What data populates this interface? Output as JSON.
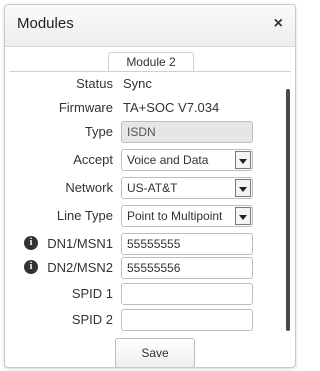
{
  "dialog": {
    "title": "Modules",
    "close_glyph": "×",
    "tab_label": "Module 2",
    "save_label": "Save"
  },
  "fields": {
    "status": {
      "label": "Status",
      "value": "Sync"
    },
    "firmware": {
      "label": "Firmware",
      "value": "TA+SOC V7.034"
    },
    "type": {
      "label": "Type",
      "value": "ISDN"
    },
    "accept": {
      "label": "Accept",
      "value": "Voice and Data"
    },
    "network": {
      "label": "Network",
      "value": "US-AT&T"
    },
    "line_type": {
      "label": "Line Type",
      "value": "Point to Multipoint"
    },
    "dn1": {
      "label": "DN1/MSN1",
      "value": "55555555"
    },
    "dn2": {
      "label": "DN2/MSN2",
      "value": "55555556"
    },
    "spid1": {
      "label": "SPID 1",
      "value": ""
    },
    "spid2": {
      "label": "SPID 2",
      "value": ""
    }
  },
  "icons": {
    "info_glyph": "i",
    "close": "close-icon",
    "info": "info-icon",
    "dropdown": "chevron-down-icon"
  }
}
